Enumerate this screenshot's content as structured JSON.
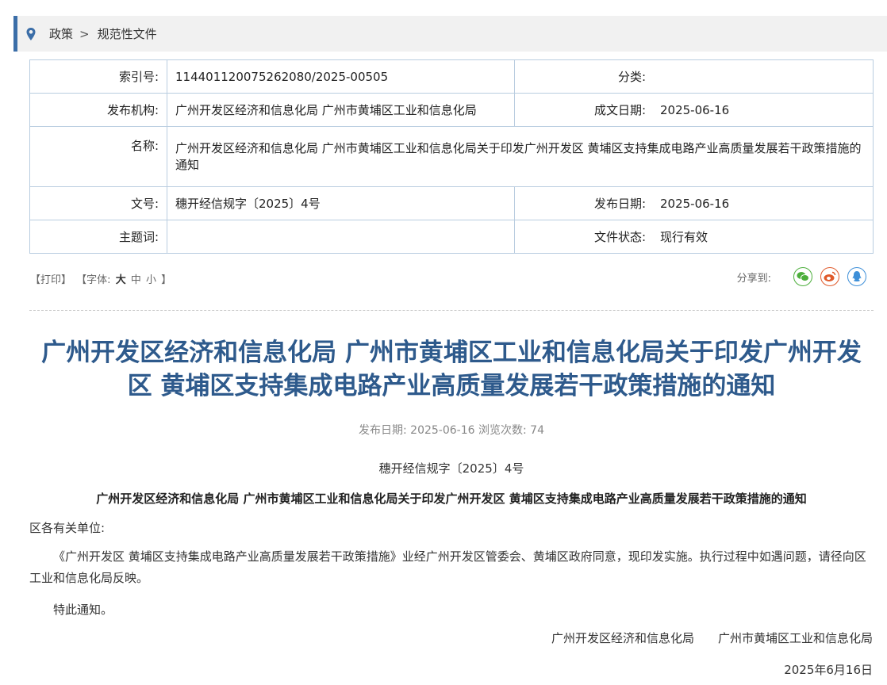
{
  "breadcrumb": {
    "items": [
      "政策",
      "规范性文件"
    ],
    "separator": ">"
  },
  "meta": {
    "index_label": "索引号:",
    "index_value": "11440112007526208​0/2025-00505",
    "category_label": "分类:",
    "category_value": "",
    "publisher_label": "发布机构:",
    "publisher_value": "广州开发区经济和信息化局 广州市黄埔区工业和信息化局",
    "created_label": "成文日期:",
    "created_value": "2025-06-16",
    "name_label": "名称:",
    "name_value": "广州开发区经济和信息化局 广州市黄埔区工业和信息化局关于印发广州开发区 黄埔区支持集成电路产业高质量发展若干政策措施的通知",
    "docno_label": "文号:",
    "docno_value": "穗开经信规字〔2025〕4号",
    "pubdate_label": "发布日期:",
    "pubdate_value": "2025-06-16",
    "subject_label": "主题词:",
    "subject_value": "",
    "status_label": "文件状态:",
    "status_value": "现行有效"
  },
  "tools": {
    "print": "【打印】",
    "font_label": "【字体:",
    "font_large": "大",
    "font_medium": "中",
    "font_small": "小",
    "font_close": "】",
    "share_label": "分享到:"
  },
  "article": {
    "title": "广州开发区经济和信息化局 广州市黄埔区工业和信息化局关于印发广州开发区 黄埔区支持集成电路产业高质量发展若干政策措施的通知",
    "info": "发布日期: 2025-06-16  浏览次数: 74",
    "doc_no": "穗开经信规字〔2025〕4号",
    "body_title": "广州开发区经济和信息化局  广州市黄埔区工业和信息化局关于印发广州开发区  黄埔区支持集成电路产业高质量发展若干政策措施的通知",
    "salutation": "区各有关单位:",
    "paragraph": "《广州开发区  黄埔区支持集成电路产业高质量发展若干政策措施》业经广州开发区管委会、黄埔区政府同意，现印发实施。执行过程中如遇问题，请径向区工业和信息化局反映。",
    "closing": "特此通知。",
    "signer1": "广州开发区经济和信息化局",
    "signer2": "广州市黄埔区工业和信息化局",
    "date": "2025年6月16日"
  },
  "colors": {
    "accent": "#3b6ea8",
    "title": "#2e5a8c",
    "border": "#b9cde0"
  },
  "icons": [
    "location-pin-icon",
    "wechat-icon",
    "weibo-icon",
    "qq-icon"
  ]
}
